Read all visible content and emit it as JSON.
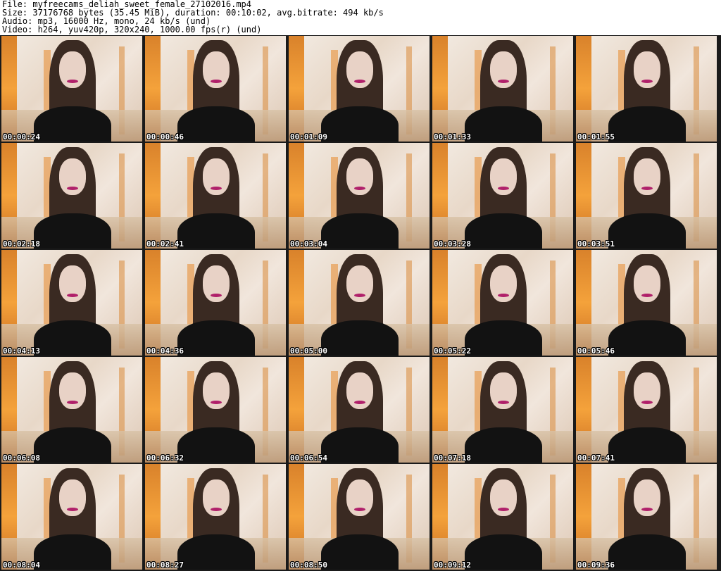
{
  "header": {
    "file": "File: myfreecams_deliah_sweet_female_27102016.mp4",
    "size": "Size: 37176768 bytes (35.45 MiB), duration: 00:10:02, avg.bitrate: 494 kb/s",
    "audio": "Audio: mp3, 16000 Hz, mono, 24 kb/s (und)",
    "video": "Video: h264, yuv420p, 320x240, 1000.00 fps(r) (und)"
  },
  "thumbnails": [
    {
      "time": "00:00:24"
    },
    {
      "time": "00:00:46"
    },
    {
      "time": "00:01:09"
    },
    {
      "time": "00:01:33"
    },
    {
      "time": "00:01:55"
    },
    {
      "time": "00:02:18"
    },
    {
      "time": "00:02:41"
    },
    {
      "time": "00:03:04"
    },
    {
      "time": "00:03:28"
    },
    {
      "time": "00:03:51"
    },
    {
      "time": "00:04:13"
    },
    {
      "time": "00:04:36"
    },
    {
      "time": "00:05:00"
    },
    {
      "time": "00:05:22"
    },
    {
      "time": "00:05:46"
    },
    {
      "time": "00:06:08"
    },
    {
      "time": "00:06:32"
    },
    {
      "time": "00:06:54"
    },
    {
      "time": "00:07:18"
    },
    {
      "time": "00:07:41"
    },
    {
      "time": "00:08:04"
    },
    {
      "time": "00:08:27"
    },
    {
      "time": "00:08:50"
    },
    {
      "time": "00:09:12"
    },
    {
      "time": "00:09:36"
    }
  ]
}
